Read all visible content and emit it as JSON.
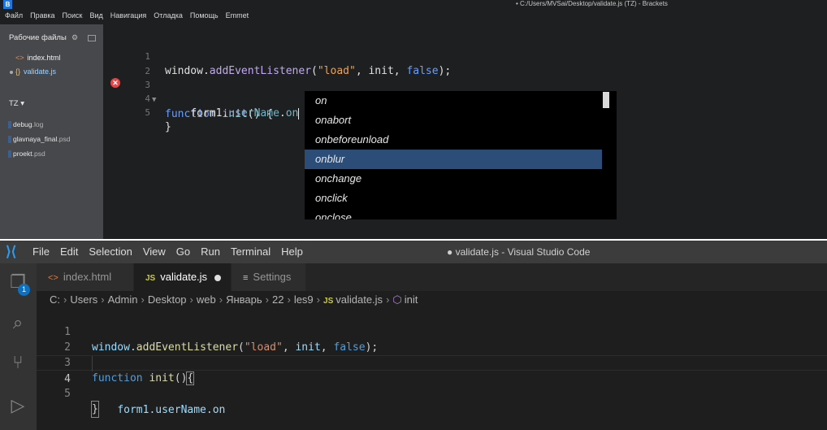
{
  "brackets": {
    "logo": "B",
    "window_title": "• C:/Users/MVSai/Desktop/validate.js (TZ) - Brackets",
    "menus": [
      "Файл",
      "Правка",
      "Поиск",
      "Вид",
      "Навигация",
      "Отладка",
      "Помощь",
      "Emmet"
    ],
    "sidebar": {
      "working_files_header": "Рабочие файлы",
      "working_files": [
        {
          "icon": "<>",
          "name": "index.html"
        },
        {
          "icon": "{}",
          "name": "validate.js"
        }
      ],
      "project_header": "TZ",
      "project_files": [
        {
          "name": "debug",
          "ext": ".log"
        },
        {
          "name": "glavnaya_final",
          "ext": ".psd"
        },
        {
          "name": "proekt",
          "ext": ".psd"
        }
      ]
    },
    "code": {
      "line_numbers": [
        "1",
        "2",
        "3",
        "4",
        "5"
      ],
      "line1": {
        "obj": "window.",
        "fn": "addEventListener",
        "open": "(",
        "str": "\"load\"",
        "rest": ", init, ",
        "kw": "false",
        "close": ");"
      },
      "line3": {
        "kw": "function",
        "fn": "init",
        "rest": "() {"
      },
      "line4": {
        "indent": "    ",
        "obj": "form1.",
        "prop": "userName",
        "dot": ".",
        "partial": "on"
      },
      "line5": "}"
    },
    "hints": [
      "on",
      "onabort",
      "onbeforeunload",
      "onblur",
      "onchange",
      "onclick",
      "onclose"
    ],
    "selected_hint": "onblur"
  },
  "vscode": {
    "window_title": "● validate.js - Visual Studio Code",
    "menus": [
      "File",
      "Edit",
      "Selection",
      "View",
      "Go",
      "Run",
      "Terminal",
      "Help"
    ],
    "activity_badge": "1",
    "tabs": [
      {
        "icon": "<>",
        "label": "index.html"
      },
      {
        "icon": "JS",
        "label": "validate.js"
      },
      {
        "icon": "≡",
        "label": "Settings"
      }
    ],
    "breadcrumbs": [
      "C:",
      "Users",
      "Admin",
      "Desktop",
      "web",
      "Январь",
      "22",
      "les9"
    ],
    "breadcrumb_file_icon": "JS",
    "breadcrumb_file": "validate.js",
    "breadcrumb_symbol": "init",
    "code": {
      "line_numbers": [
        "1",
        "2",
        "3",
        "4",
        "5"
      ],
      "line1": {
        "obj": "window.",
        "fn": "addEventListener",
        "open": "(",
        "str": "\"load\"",
        "mid": ", ",
        "id": "init",
        "comma": ", ",
        "kw": "false",
        "close": ");"
      },
      "line3": {
        "kw": "function",
        "sp": " ",
        "fn": "init",
        "paren": "()",
        "brace": "{"
      },
      "line4": {
        "indent": "    ",
        "text": "form1.userName.on"
      },
      "line5": "}"
    }
  }
}
